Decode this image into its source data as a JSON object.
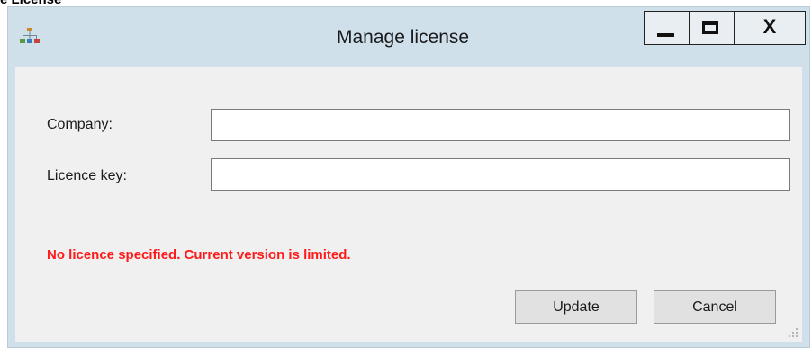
{
  "page_heading": "e License",
  "window": {
    "title": "Manage license",
    "close_label": "X",
    "icon": "network-hierarchy-icon"
  },
  "form": {
    "company_label": "Company:",
    "company_value": "",
    "licence_key_label": "Licence key:",
    "licence_key_value": "",
    "status_message": "No licence specified. Current version is limited.",
    "status_color": "#ff1a1a"
  },
  "buttons": {
    "update_label": "Update",
    "cancel_label": "Cancel"
  },
  "colors": {
    "titlebar": "#cfe0eb",
    "client": "#f0f0f0",
    "button_face": "#e1e1e1"
  }
}
